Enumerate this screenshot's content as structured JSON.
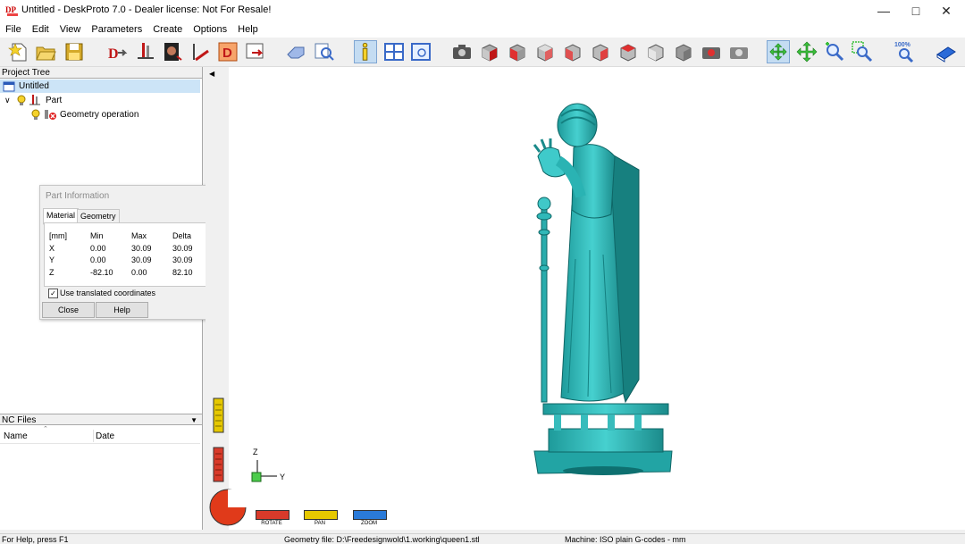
{
  "window": {
    "title": "Untitled - DeskProto 7.0 - Dealer license: Not For Resale!"
  },
  "menubar": {
    "items": [
      "File",
      "Edit",
      "View",
      "Parameters",
      "Create",
      "Options",
      "Help"
    ]
  },
  "project_tree": {
    "header": "Project Tree",
    "items": [
      {
        "label": "Untitled"
      },
      {
        "label": "Part"
      },
      {
        "label": "Geometry operation"
      }
    ]
  },
  "nc_files": {
    "header": "NC Files",
    "columns": [
      "Name",
      "Date"
    ]
  },
  "dialog": {
    "title": "Part Information",
    "tabs": [
      "Material",
      "Geometry"
    ],
    "table": {
      "headers": [
        "[mm]",
        "Min",
        "Max",
        "Delta"
      ],
      "rows": [
        [
          "X",
          "0.00",
          "30.09",
          "30.09"
        ],
        [
          "Y",
          "0.00",
          "30.09",
          "30.09"
        ],
        [
          "Z",
          "-82.10",
          "0.00",
          "82.10"
        ]
      ]
    },
    "checkbox_label": "Use translated coordinates",
    "close_label": "Close",
    "help_label": "Help"
  },
  "viewport": {
    "axis_z": "Z",
    "axis_y": "Y",
    "nav": [
      "ROTATE",
      "PAN",
      "ZOOM"
    ],
    "zoom_toolbar_label": "100%"
  },
  "statusbar": {
    "help": "For Help, press F1",
    "geometry": "Geometry file: D:\\Freedesignwold\\1.working\\queen1.stl",
    "machine": "Machine: ISO plain G-codes - mm"
  },
  "colors": {
    "model": "#33c1c1",
    "accent": "#0078d7"
  }
}
